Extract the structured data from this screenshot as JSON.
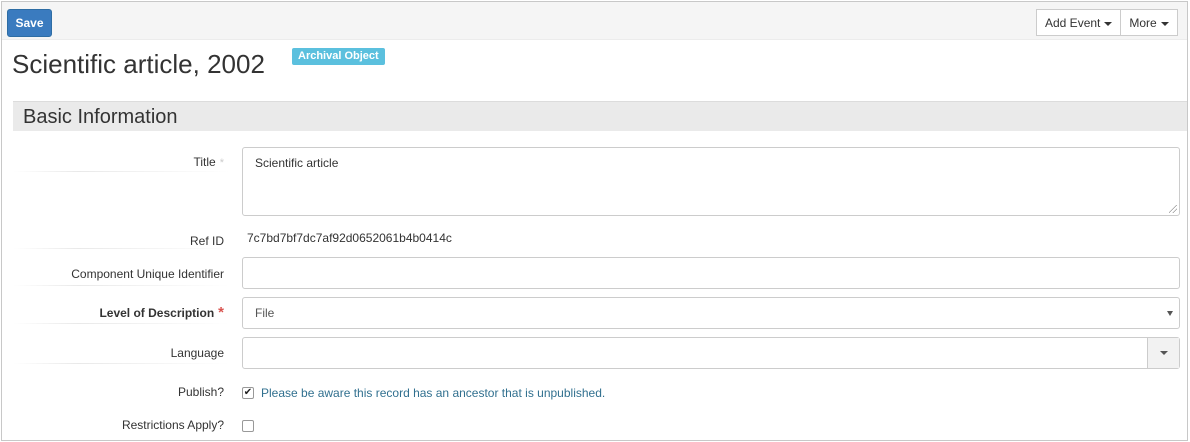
{
  "toolbar": {
    "save_label": "Save",
    "add_event_label": "Add Event",
    "more_label": "More"
  },
  "page": {
    "title": "Scientific article, 2002",
    "badge": "Archival Object"
  },
  "section": {
    "title": "Basic Information"
  },
  "fields": {
    "title": {
      "label": "Title",
      "value": "Scientific article"
    },
    "ref_id": {
      "label": "Ref ID",
      "value": "7c7bd7bf7dc7af92d0652061b4b0414c"
    },
    "component_unique_identifier": {
      "label": "Component Unique Identifier",
      "value": ""
    },
    "level_of_description": {
      "label": "Level of Description",
      "selected": "File"
    },
    "language": {
      "label": "Language",
      "value": ""
    },
    "publish": {
      "label": "Publish?",
      "checked": true,
      "notice": "Please be aware this record has an ancestor that is unpublished."
    },
    "restrictions_apply": {
      "label": "Restrictions Apply?",
      "checked": false
    }
  },
  "markers": {
    "required": "*",
    "optional": "*"
  },
  "colors": {
    "primary": "#3a7bbf",
    "badge": "#5bc0de",
    "required": "#d9534f",
    "notice": "#31708f"
  }
}
